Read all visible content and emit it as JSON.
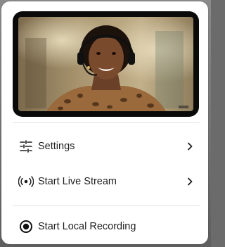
{
  "menu": {
    "settings_label": "Settings",
    "live_stream_label": "Start Live Stream",
    "local_recording_label": "Start Local Recording"
  },
  "icons": {
    "settings": "sliders-icon",
    "live_stream": "broadcast-icon",
    "local_recording": "record-icon",
    "submenu": "chevron-right-icon"
  },
  "colors": {
    "panel_background": "#ffffff",
    "text": "#1f1f1f",
    "divider": "#e2e2e2",
    "preview_frame": "#0a0a0a"
  }
}
